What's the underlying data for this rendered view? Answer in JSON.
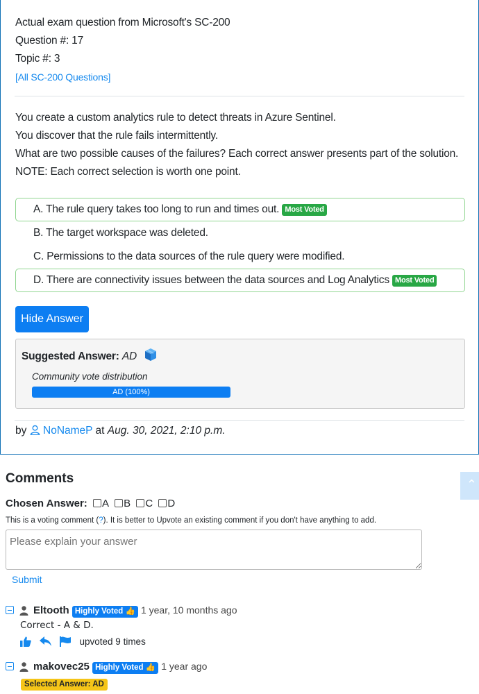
{
  "exam": {
    "source_line": "Actual exam question from Microsoft's SC-200",
    "question_number": "Question #: 17",
    "topic": "Topic #: 3",
    "all_questions_link": "[All SC-200 Questions]"
  },
  "question": {
    "lines": [
      "You create a custom analytics rule to detect threats in Azure Sentinel.",
      "You discover that the rule fails intermittently.",
      "What are two possible causes of the failures? Each correct answer presents part of the solution.",
      "NOTE: Each correct selection is worth one point."
    ]
  },
  "choices": [
    {
      "text": "A. The rule query takes too long to run and times out.",
      "badge": "Most Voted",
      "correct": true
    },
    {
      "text": "B. The target workspace was deleted.",
      "badge": "",
      "correct": false
    },
    {
      "text": "C. Permissions to the data sources of the rule query were modified.",
      "badge": "",
      "correct": false
    },
    {
      "text": "D. There are connectivity issues between the data sources and Log Analytics",
      "badge": "Most Voted",
      "correct": true
    }
  ],
  "hide_answer_button": "Hide Answer",
  "suggested": {
    "label": "Suggested Answer:",
    "answer": "AD",
    "vote_label": "Community vote distribution",
    "vote_bar_text": "AD (100%)",
    "vote_fraction": 1.0
  },
  "byline": {
    "by": "by",
    "user": "NoNameP",
    "at": "at",
    "date": "Aug. 30, 2021, 2:10 p.m."
  },
  "comments_section": {
    "title": "Comments",
    "chosen_label": "Chosen Answer:",
    "options": [
      "A",
      "B",
      "C",
      "D"
    ],
    "voting_note_pre": "This is a voting comment (",
    "voting_note_link": "?",
    "voting_note_post": "). It is better to Upvote an existing comment if you don't have anything to add.",
    "textarea_placeholder": "Please explain your answer",
    "submit_label": "Submit"
  },
  "comments": [
    {
      "user": "Eltooth",
      "badge": "Highly Voted",
      "time": "1 year, 10 months ago",
      "text": "Correct - A & D.",
      "upvoted": "upvoted 9 times"
    },
    {
      "user": "makovec25",
      "badge": "Highly Voted",
      "time": "1 year ago",
      "selected_answer": "Selected Answer: AD"
    }
  ],
  "colors": {
    "accent": "#0d7ef2",
    "link": "#1589ee",
    "most_voted": "#28a745",
    "selected_badge": "#f5c518"
  }
}
